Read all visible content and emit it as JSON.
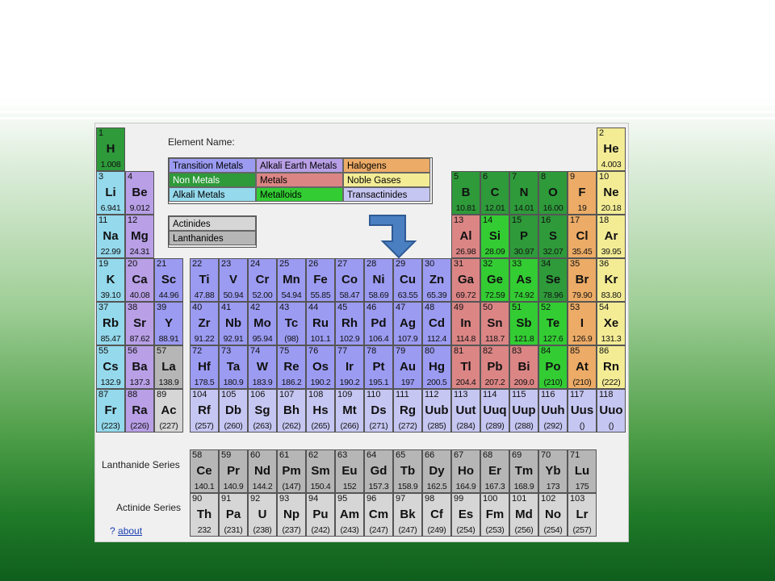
{
  "app": {
    "element_name_label": "Element Name:",
    "lanthanide_series_label": "Lanthanide Series",
    "actinide_series_label": "Actinide Series",
    "about_prefix": "? ",
    "about_link": "about"
  },
  "legend": [
    {
      "label": "Transition Metals",
      "type": "transition"
    },
    {
      "label": "Alkali Earth Metals",
      "type": "alkaline"
    },
    {
      "label": "Halogens",
      "type": "halogen"
    },
    {
      "label": "Non Metals",
      "type": "nonmetal"
    },
    {
      "label": "Metals",
      "type": "metal"
    },
    {
      "label": "Noble Gases",
      "type": "noble"
    },
    {
      "label": "Alkali Metals",
      "type": "alkali"
    },
    {
      "label": "Metalloids",
      "type": "metalloid"
    },
    {
      "label": "Transactinides",
      "type": "trans"
    }
  ],
  "legend2": [
    {
      "label": "Actinides",
      "type": "actinide"
    },
    {
      "label": "Lanthanides",
      "type": "lanthanide"
    }
  ],
  "colors": {
    "transition": "#9b9bf2",
    "alkali": "#94d9ec",
    "alkaline": "#b89fe6",
    "nonmetal": "#2e9a3a",
    "metal": "#db8585",
    "metalloid": "#33cc33",
    "halogen": "#ecab66",
    "noble": "#f3ec95",
    "trans": "#c6c6f2",
    "actinide": "#d6d6d6",
    "lanthanide": "#b6b6b6",
    "arrow": "#4a7fc1"
  },
  "elements": [
    {
      "n": "1",
      "s": "H",
      "m": "1.008",
      "t": "nonmetal",
      "r": 1,
      "c": 1
    },
    {
      "n": "2",
      "s": "He",
      "m": "4.003",
      "t": "noble",
      "r": 1,
      "c": 18
    },
    {
      "n": "3",
      "s": "Li",
      "m": "6.941",
      "t": "alkali",
      "r": 2,
      "c": 1
    },
    {
      "n": "4",
      "s": "Be",
      "m": "9.012",
      "t": "alkaline",
      "r": 2,
      "c": 2
    },
    {
      "n": "5",
      "s": "B",
      "m": "10.81",
      "t": "nonmetal",
      "r": 2,
      "c": 13
    },
    {
      "n": "6",
      "s": "C",
      "m": "12.01",
      "t": "nonmetal",
      "r": 2,
      "c": 14
    },
    {
      "n": "7",
      "s": "N",
      "m": "14.01",
      "t": "nonmetal",
      "r": 2,
      "c": 15
    },
    {
      "n": "8",
      "s": "O",
      "m": "16.00",
      "t": "nonmetal",
      "r": 2,
      "c": 16
    },
    {
      "n": "9",
      "s": "F",
      "m": "19",
      "t": "halogen",
      "r": 2,
      "c": 17
    },
    {
      "n": "10",
      "s": "Ne",
      "m": "20.18",
      "t": "noble",
      "r": 2,
      "c": 18
    },
    {
      "n": "11",
      "s": "Na",
      "m": "22.99",
      "t": "alkali",
      "r": 3,
      "c": 1
    },
    {
      "n": "12",
      "s": "Mg",
      "m": "24.31",
      "t": "alkaline",
      "r": 3,
      "c": 2
    },
    {
      "n": "13",
      "s": "Al",
      "m": "26.98",
      "t": "metal",
      "r": 3,
      "c": 13
    },
    {
      "n": "14",
      "s": "Si",
      "m": "28.09",
      "t": "metalloid",
      "r": 3,
      "c": 14
    },
    {
      "n": "15",
      "s": "P",
      "m": "30.97",
      "t": "nonmetal",
      "r": 3,
      "c": 15
    },
    {
      "n": "16",
      "s": "S",
      "m": "32.07",
      "t": "nonmetal",
      "r": 3,
      "c": 16
    },
    {
      "n": "17",
      "s": "Cl",
      "m": "35.45",
      "t": "halogen",
      "r": 3,
      "c": 17
    },
    {
      "n": "18",
      "s": "Ar",
      "m": "39.95",
      "t": "noble",
      "r": 3,
      "c": 18
    },
    {
      "n": "19",
      "s": "K",
      "m": "39.10",
      "t": "alkali",
      "r": 4,
      "c": 1
    },
    {
      "n": "20",
      "s": "Ca",
      "m": "40.08",
      "t": "alkaline",
      "r": 4,
      "c": 2
    },
    {
      "n": "21",
      "s": "Sc",
      "m": "44.96",
      "t": "transition",
      "r": 4,
      "c": 3
    },
    {
      "n": "22",
      "s": "Ti",
      "m": "47.88",
      "t": "transition",
      "r": 4,
      "c": 4
    },
    {
      "n": "23",
      "s": "V",
      "m": "50.94",
      "t": "transition",
      "r": 4,
      "c": 5
    },
    {
      "n": "24",
      "s": "Cr",
      "m": "52.00",
      "t": "transition",
      "r": 4,
      "c": 6
    },
    {
      "n": "25",
      "s": "Mn",
      "m": "54.94",
      "t": "transition",
      "r": 4,
      "c": 7
    },
    {
      "n": "26",
      "s": "Fe",
      "m": "55.85",
      "t": "transition",
      "r": 4,
      "c": 8
    },
    {
      "n": "27",
      "s": "Co",
      "m": "58.47",
      "t": "transition",
      "r": 4,
      "c": 9
    },
    {
      "n": "28",
      "s": "Ni",
      "m": "58.69",
      "t": "transition",
      "r": 4,
      "c": 10
    },
    {
      "n": "29",
      "s": "Cu",
      "m": "63.55",
      "t": "transition",
      "r": 4,
      "c": 11
    },
    {
      "n": "30",
      "s": "Zn",
      "m": "65.39",
      "t": "transition",
      "r": 4,
      "c": 12
    },
    {
      "n": "31",
      "s": "Ga",
      "m": "69.72",
      "t": "metal",
      "r": 4,
      "c": 13
    },
    {
      "n": "32",
      "s": "Ge",
      "m": "72.59",
      "t": "metalloid",
      "r": 4,
      "c": 14
    },
    {
      "n": "33",
      "s": "As",
      "m": "74.92",
      "t": "metalloid",
      "r": 4,
      "c": 15
    },
    {
      "n": "34",
      "s": "Se",
      "m": "78.96",
      "t": "nonmetal",
      "r": 4,
      "c": 16
    },
    {
      "n": "35",
      "s": "Br",
      "m": "79.90",
      "t": "halogen",
      "r": 4,
      "c": 17
    },
    {
      "n": "36",
      "s": "Kr",
      "m": "83.80",
      "t": "noble",
      "r": 4,
      "c": 18
    },
    {
      "n": "37",
      "s": "Rb",
      "m": "85.47",
      "t": "alkali",
      "r": 5,
      "c": 1
    },
    {
      "n": "38",
      "s": "Sr",
      "m": "87.62",
      "t": "alkaline",
      "r": 5,
      "c": 2
    },
    {
      "n": "39",
      "s": "Y",
      "m": "88.91",
      "t": "transition",
      "r": 5,
      "c": 3
    },
    {
      "n": "40",
      "s": "Zr",
      "m": "91.22",
      "t": "transition",
      "r": 5,
      "c": 4
    },
    {
      "n": "41",
      "s": "Nb",
      "m": "92.91",
      "t": "transition",
      "r": 5,
      "c": 5
    },
    {
      "n": "42",
      "s": "Mo",
      "m": "95.94",
      "t": "transition",
      "r": 5,
      "c": 6
    },
    {
      "n": "43",
      "s": "Tc",
      "m": "(98)",
      "t": "transition",
      "r": 5,
      "c": 7
    },
    {
      "n": "44",
      "s": "Ru",
      "m": "101.1",
      "t": "transition",
      "r": 5,
      "c": 8
    },
    {
      "n": "45",
      "s": "Rh",
      "m": "102.9",
      "t": "transition",
      "r": 5,
      "c": 9
    },
    {
      "n": "46",
      "s": "Pd",
      "m": "106.4",
      "t": "transition",
      "r": 5,
      "c": 10
    },
    {
      "n": "47",
      "s": "Ag",
      "m": "107.9",
      "t": "transition",
      "r": 5,
      "c": 11
    },
    {
      "n": "48",
      "s": "Cd",
      "m": "112.4",
      "t": "transition",
      "r": 5,
      "c": 12
    },
    {
      "n": "49",
      "s": "In",
      "m": "114.8",
      "t": "metal",
      "r": 5,
      "c": 13
    },
    {
      "n": "50",
      "s": "Sn",
      "m": "118.7",
      "t": "metal",
      "r": 5,
      "c": 14
    },
    {
      "n": "51",
      "s": "Sb",
      "m": "121.8",
      "t": "metalloid",
      "r": 5,
      "c": 15
    },
    {
      "n": "52",
      "s": "Te",
      "m": "127.6",
      "t": "metalloid",
      "r": 5,
      "c": 16
    },
    {
      "n": "53",
      "s": "I",
      "m": "126.9",
      "t": "halogen",
      "r": 5,
      "c": 17
    },
    {
      "n": "54",
      "s": "Xe",
      "m": "131.3",
      "t": "noble",
      "r": 5,
      "c": 18
    },
    {
      "n": "55",
      "s": "Cs",
      "m": "132.9",
      "t": "alkali",
      "r": 6,
      "c": 1
    },
    {
      "n": "56",
      "s": "Ba",
      "m": "137.3",
      "t": "alkaline",
      "r": 6,
      "c": 2
    },
    {
      "n": "57",
      "s": "La",
      "m": "138.9",
      "t": "lanthanide",
      "r": 6,
      "c": 3
    },
    {
      "n": "72",
      "s": "Hf",
      "m": "178.5",
      "t": "transition",
      "r": 6,
      "c": 4
    },
    {
      "n": "73",
      "s": "Ta",
      "m": "180.9",
      "t": "transition",
      "r": 6,
      "c": 5
    },
    {
      "n": "74",
      "s": "W",
      "m": "183.9",
      "t": "transition",
      "r": 6,
      "c": 6
    },
    {
      "n": "75",
      "s": "Re",
      "m": "186.2",
      "t": "transition",
      "r": 6,
      "c": 7
    },
    {
      "n": "76",
      "s": "Os",
      "m": "190.2",
      "t": "transition",
      "r": 6,
      "c": 8
    },
    {
      "n": "77",
      "s": "Ir",
      "m": "190.2",
      "t": "transition",
      "r": 6,
      "c": 9
    },
    {
      "n": "78",
      "s": "Pt",
      "m": "195.1",
      "t": "transition",
      "r": 6,
      "c": 10
    },
    {
      "n": "79",
      "s": "Au",
      "m": "197",
      "t": "transition",
      "r": 6,
      "c": 11
    },
    {
      "n": "80",
      "s": "Hg",
      "m": "200.5",
      "t": "transition",
      "r": 6,
      "c": 12
    },
    {
      "n": "81",
      "s": "Tl",
      "m": "204.4",
      "t": "metal",
      "r": 6,
      "c": 13
    },
    {
      "n": "82",
      "s": "Pb",
      "m": "207.2",
      "t": "metal",
      "r": 6,
      "c": 14
    },
    {
      "n": "83",
      "s": "Bi",
      "m": "209.0",
      "t": "metal",
      "r": 6,
      "c": 15
    },
    {
      "n": "84",
      "s": "Po",
      "m": "(210)",
      "t": "metalloid",
      "r": 6,
      "c": 16
    },
    {
      "n": "85",
      "s": "At",
      "m": "(210)",
      "t": "halogen",
      "r": 6,
      "c": 17
    },
    {
      "n": "86",
      "s": "Rn",
      "m": "(222)",
      "t": "noble",
      "r": 6,
      "c": 18
    },
    {
      "n": "87",
      "s": "Fr",
      "m": "(223)",
      "t": "alkali",
      "r": 7,
      "c": 1
    },
    {
      "n": "88",
      "s": "Ra",
      "m": "(226)",
      "t": "alkaline",
      "r": 7,
      "c": 2
    },
    {
      "n": "89",
      "s": "Ac",
      "m": "(227)",
      "t": "actinide",
      "r": 7,
      "c": 3
    },
    {
      "n": "104",
      "s": "Rf",
      "m": "(257)",
      "t": "trans",
      "r": 7,
      "c": 4
    },
    {
      "n": "105",
      "s": "Db",
      "m": "(260)",
      "t": "trans",
      "r": 7,
      "c": 5
    },
    {
      "n": "106",
      "s": "Sg",
      "m": "(263)",
      "t": "trans",
      "r": 7,
      "c": 6
    },
    {
      "n": "107",
      "s": "Bh",
      "m": "(262)",
      "t": "trans",
      "r": 7,
      "c": 7
    },
    {
      "n": "108",
      "s": "Hs",
      "m": "(265)",
      "t": "trans",
      "r": 7,
      "c": 8
    },
    {
      "n": "109",
      "s": "Mt",
      "m": "(266)",
      "t": "trans",
      "r": 7,
      "c": 9
    },
    {
      "n": "110",
      "s": "Ds",
      "m": "(271)",
      "t": "trans",
      "r": 7,
      "c": 10
    },
    {
      "n": "111",
      "s": "Rg",
      "m": "(272)",
      "t": "trans",
      "r": 7,
      "c": 11
    },
    {
      "n": "112",
      "s": "Uub",
      "m": "(285)",
      "t": "trans",
      "r": 7,
      "c": 12
    },
    {
      "n": "113",
      "s": "Uut",
      "m": "(284)",
      "t": "trans",
      "r": 7,
      "c": 13
    },
    {
      "n": "114",
      "s": "Uuq",
      "m": "(289)",
      "t": "trans",
      "r": 7,
      "c": 14
    },
    {
      "n": "115",
      "s": "Uup",
      "m": "(288)",
      "t": "trans",
      "r": 7,
      "c": 15
    },
    {
      "n": "116",
      "s": "Uuh",
      "m": "(292)",
      "t": "trans",
      "r": 7,
      "c": 16
    },
    {
      "n": "117",
      "s": "Uus",
      "m": "()",
      "t": "trans",
      "r": 7,
      "c": 17
    },
    {
      "n": "118",
      "s": "Uuo",
      "m": "()",
      "t": "trans",
      "r": 7,
      "c": 18
    }
  ],
  "lanthanides": [
    {
      "n": "58",
      "s": "Ce",
      "m": "140.1"
    },
    {
      "n": "59",
      "s": "Pr",
      "m": "140.9"
    },
    {
      "n": "60",
      "s": "Nd",
      "m": "144.2"
    },
    {
      "n": "61",
      "s": "Pm",
      "m": "(147)"
    },
    {
      "n": "62",
      "s": "Sm",
      "m": "150.4"
    },
    {
      "n": "63",
      "s": "Eu",
      "m": "152"
    },
    {
      "n": "64",
      "s": "Gd",
      "m": "157.3"
    },
    {
      "n": "65",
      "s": "Tb",
      "m": "158.9"
    },
    {
      "n": "66",
      "s": "Dy",
      "m": "162.5"
    },
    {
      "n": "67",
      "s": "Ho",
      "m": "164.9"
    },
    {
      "n": "68",
      "s": "Er",
      "m": "167.3"
    },
    {
      "n": "69",
      "s": "Tm",
      "m": "168.9"
    },
    {
      "n": "70",
      "s": "Yb",
      "m": "173"
    },
    {
      "n": "71",
      "s": "Lu",
      "m": "175"
    }
  ],
  "actinides": [
    {
      "n": "90",
      "s": "Th",
      "m": "232"
    },
    {
      "n": "91",
      "s": "Pa",
      "m": "(231)"
    },
    {
      "n": "92",
      "s": "U",
      "m": "(238)"
    },
    {
      "n": "93",
      "s": "Np",
      "m": "(237)"
    },
    {
      "n": "94",
      "s": "Pu",
      "m": "(242)"
    },
    {
      "n": "95",
      "s": "Am",
      "m": "(243)"
    },
    {
      "n": "96",
      "s": "Cm",
      "m": "(247)"
    },
    {
      "n": "97",
      "s": "Bk",
      "m": "(247)"
    },
    {
      "n": "98",
      "s": "Cf",
      "m": "(249)"
    },
    {
      "n": "99",
      "s": "Es",
      "m": "(254)"
    },
    {
      "n": "100",
      "s": "Fm",
      "m": "(253)"
    },
    {
      "n": "101",
      "s": "Md",
      "m": "(256)"
    },
    {
      "n": "102",
      "s": "No",
      "m": "(254)"
    },
    {
      "n": "103",
      "s": "Lr",
      "m": "(257)"
    }
  ]
}
